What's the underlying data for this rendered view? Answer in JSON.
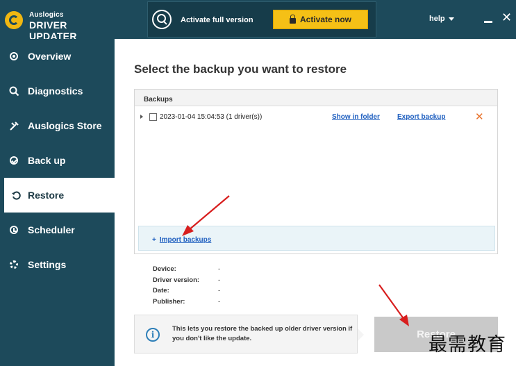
{
  "brand": {
    "line1": "Auslogics",
    "line2": "DRIVER UPDATER"
  },
  "header": {
    "activate_text": "Activate full version",
    "activate_button": "Activate now",
    "help_label": "help",
    "close_glyph": "✕"
  },
  "sidebar": {
    "items": [
      {
        "label": "Overview",
        "icon": "overview-icon"
      },
      {
        "label": "Diagnostics",
        "icon": "search-icon"
      },
      {
        "label": "Auslogics Store",
        "icon": "tools-icon"
      },
      {
        "label": "Back up",
        "icon": "check-circle-icon"
      },
      {
        "label": "Restore",
        "icon": "restore-icon",
        "active": true
      },
      {
        "label": "Scheduler",
        "icon": "clock-icon"
      },
      {
        "label": "Settings",
        "icon": "gear-icon"
      }
    ]
  },
  "main": {
    "title": "Select the backup you want to restore",
    "backups_header": "Backups",
    "backup_item": {
      "label": "2023-01-04 15:04:53 (1 driver(s))",
      "show_in_folder": "Show in folder",
      "export_backup": "Export backup",
      "delete_glyph": "✕"
    },
    "import_plus": "+",
    "import_label": "Import backups",
    "details": [
      {
        "label": "Device:",
        "value": "-"
      },
      {
        "label": "Driver version:",
        "value": "-"
      },
      {
        "label": "Date:",
        "value": "-"
      },
      {
        "label": "Publisher:",
        "value": "-"
      }
    ],
    "info_glyph": "i",
    "info_text": "This lets you restore the backed up older driver version if you don't like the update.",
    "restore_button": "Restore"
  },
  "watermark": "最需教育",
  "colors": {
    "sidebar_bg": "#1d4a5b",
    "accent_yellow": "#f5c016",
    "link_blue": "#2060c0",
    "delete_orange": "#e8712a",
    "arrow_red": "#d81e1e"
  }
}
